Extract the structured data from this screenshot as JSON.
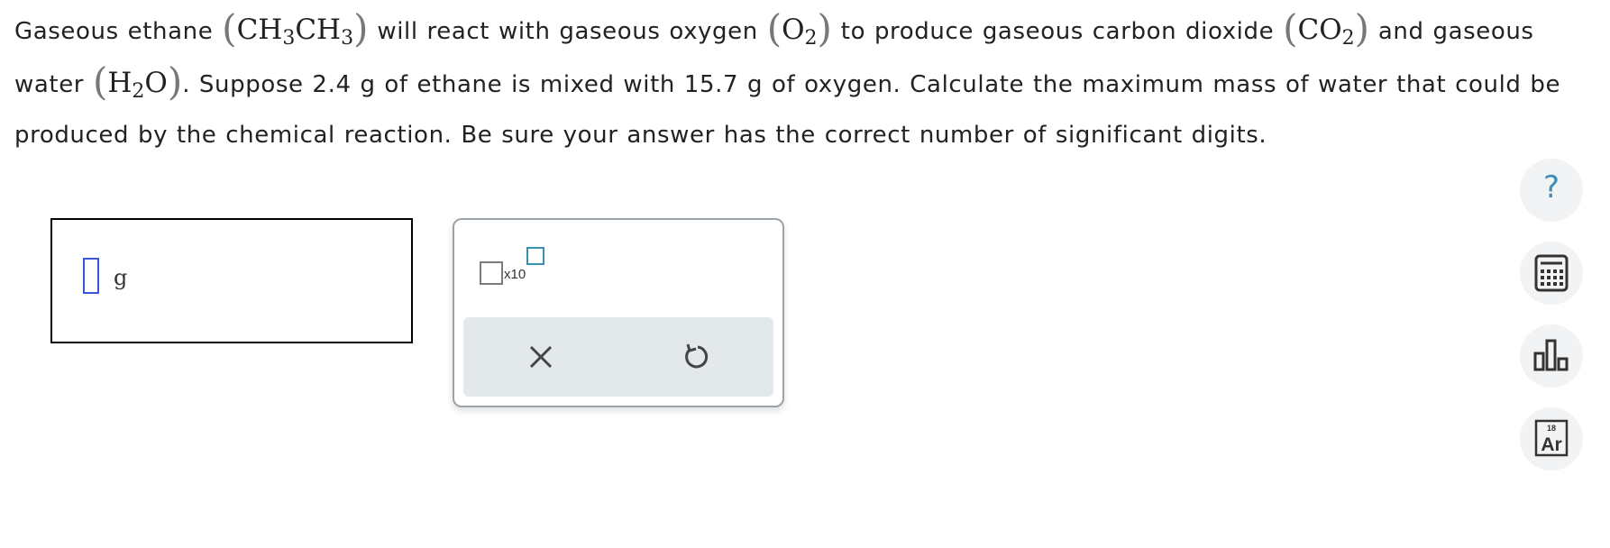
{
  "question": {
    "p1": "Gaseous ethane",
    "p2": "will react with gaseous oxygen",
    "p3": "to produce gaseous carbon dioxide",
    "p4": "and gaseous water",
    "p5": ". Suppose 2.4 g of ethane is mixed with 15.7 g of oxygen. Calculate the maximum mass of water that could be produced by the chemical reaction. Be sure your answer has the correct number of significant digits.",
    "formulas": {
      "ethane": {
        "a": "CH",
        "a_sub": "3",
        "b": "CH",
        "b_sub": "3"
      },
      "oxygen": {
        "a": "O",
        "a_sub": "2"
      },
      "carbon_dioxide": {
        "a": "CO",
        "a_sub": "2"
      },
      "water": {
        "a": "H",
        "a_sub": "2",
        "b": "O"
      }
    },
    "paren_open": "(",
    "paren_close": ")"
  },
  "answer": {
    "value": "",
    "unit": "g"
  },
  "tools": {
    "sci_notation_label": "x10",
    "clear_icon": "close-icon",
    "undo_icon": "undo-icon"
  },
  "side_tools": {
    "help_label": "?",
    "calculator_icon": "calculator-icon",
    "data_icon": "bar-chart-icon",
    "periodic_table": {
      "number": "18",
      "symbol": "Ar"
    }
  },
  "colors": {
    "accent": "#3d8fb5",
    "input_border": "#3a55d6",
    "action_bar": "#e3e8ea",
    "side_button": "#f1f3f4"
  }
}
